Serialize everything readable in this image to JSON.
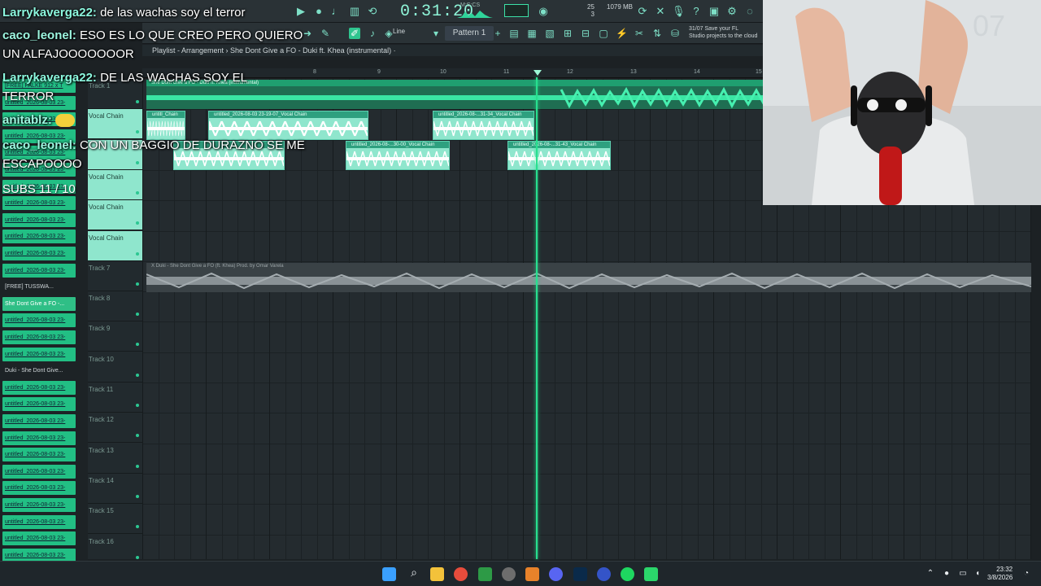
{
  "app": {
    "time_display": "0:31:20",
    "time_units": "M:S:CS",
    "memory": "1079 MB",
    "cpu_val": "25",
    "cpu_val2": "3",
    "snap_mode": "Line",
    "pattern": "Pattern 1",
    "save_hint_line1": "31/07  Save your FL",
    "save_hint_line2": "Studio projects to the cloud",
    "playlist_title": "Playlist - Arrangement › She Dont Give a FO - Duki ft. Khea (instrumental) ·",
    "bar_numbers": [
      "8",
      "9",
      "10",
      "11",
      "12",
      "13",
      "14",
      "15"
    ]
  },
  "browser": {
    "items": [
      "[FREE] FALKE 912 x T",
      "untitled_2026-08-03 23-",
      "untitled_2026-08-03 23-",
      "untitled_2026-08-03 23-",
      "untitled_2026-08-03 23-",
      "untitled_2026-08-03 23-",
      "untitled_2026-08-03 23-",
      "untitled_2026-08-03 23-",
      "untitled_2026-08-03 23-",
      "untitled_2026-08-03 23-",
      "untitled_2026-08-03 23-",
      "untitled_2026-08-03 23-",
      "[FREE] TUSSWA...",
      "She Dont Give a FO -...",
      "untitled_2026-08-03 23-",
      "untitled_2026-08-03 23-",
      "untitled_2026-08-03 23-",
      "Duki - She Dont Give...",
      "untitled_2026-08-03 23-",
      "untitled_2026-08-03 23-",
      "untitled_2026-08-03 23-",
      "untitled_2026-08-03 23-",
      "untitled_2026-08-03 23-",
      "untitled_2026-08-03 23-",
      "untitled_2026-08-03 23-",
      "untitled_2026-08-03 23-",
      "untitled_2026-08-03 23-",
      "untitled_2026-08-03 23-",
      "untitled_2026-08-03 23-",
      "untitled_2026-08-03 23-"
    ]
  },
  "tracks": [
    {
      "label": "Track 1",
      "vocal": false
    },
    {
      "label": "Vocal Chain",
      "vocal": true
    },
    {
      "label": "",
      "vocal": true
    },
    {
      "label": "Vocal Chain",
      "vocal": true
    },
    {
      "label": "Vocal Chain",
      "vocal": true
    },
    {
      "label": "Vocal Chain",
      "vocal": true
    },
    {
      "label": "Track 7",
      "vocal": false
    },
    {
      "label": "Track 8",
      "vocal": false
    },
    {
      "label": "Track 9",
      "vocal": false
    },
    {
      "label": "Track 10",
      "vocal": false
    },
    {
      "label": "Track 11",
      "vocal": false
    },
    {
      "label": "Track 12",
      "vocal": false
    },
    {
      "label": "Track 13",
      "vocal": false
    },
    {
      "label": "Track 14",
      "vocal": false
    },
    {
      "label": "Track 15",
      "vocal": false
    },
    {
      "label": "Track 16",
      "vocal": false
    }
  ],
  "clips": {
    "instrumental": "She Dont Give a FO - Duki ft. Khea (instrumental)",
    "reference": "X Duki - She Dont Give a FO (ft. Khea) Prod. by Omar Varela",
    "vocal": [
      "untitl_Chain",
      "untitled_2026-08-03 23-19-07_Vocal Chain",
      "untitled_2026-08-...31-34_Vocal Chain",
      "untitled_2026-08-...30-00_Vocal Chain",
      "untitled_2026-08-...31-43_Vocal Chain"
    ]
  },
  "chat": [
    {
      "user": "Larrykaverga22:",
      "text": " de las wachas soy el terror"
    },
    {
      "user": "caco_leonel:",
      "text": " ESO ES LO QUE CREO PERO QUIERO UN ALFAJOOOOOOOR"
    },
    {
      "user": "Larrykaverga22:",
      "text": " DE LAS WACHAS SOY EL TERROR"
    },
    {
      "user": "anitablz:",
      "text": ""
    },
    {
      "user": "caco_leonel:",
      "text": " CON UN BAGGIO DE DURAZNO SE ME ESCAPOOOO"
    }
  ],
  "subs": "SUBS 11 / 10",
  "taskbar": {
    "time": "23:32",
    "date": "3/8/2026"
  }
}
